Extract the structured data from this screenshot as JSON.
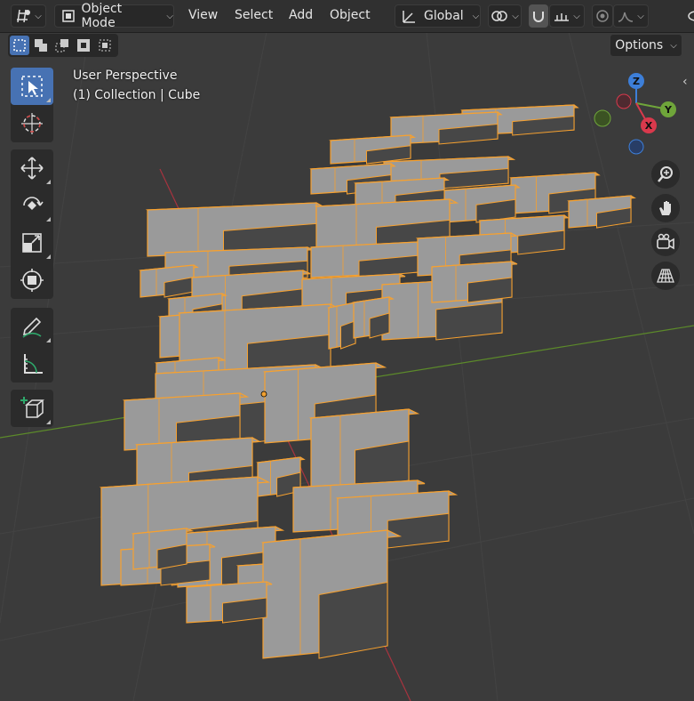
{
  "header": {
    "mode": "Object Mode",
    "menus": [
      "View",
      "Select",
      "Add",
      "Object"
    ],
    "orientation": "Global",
    "options": "Options"
  },
  "viewport": {
    "view_name": "User Perspective",
    "collection_label": "(1) Collection | Cube"
  },
  "gizmo": {
    "x": "X",
    "y": "Y",
    "z": "Z"
  },
  "colors": {
    "selection_outline": "#f7a12f",
    "face_top": "#9a9a9a",
    "face_side": "#474747",
    "active_tool": "#4772b3",
    "axis_x": "#d9394c",
    "axis_y": "#6fa53a",
    "axis_z": "#3d7fd9"
  }
}
